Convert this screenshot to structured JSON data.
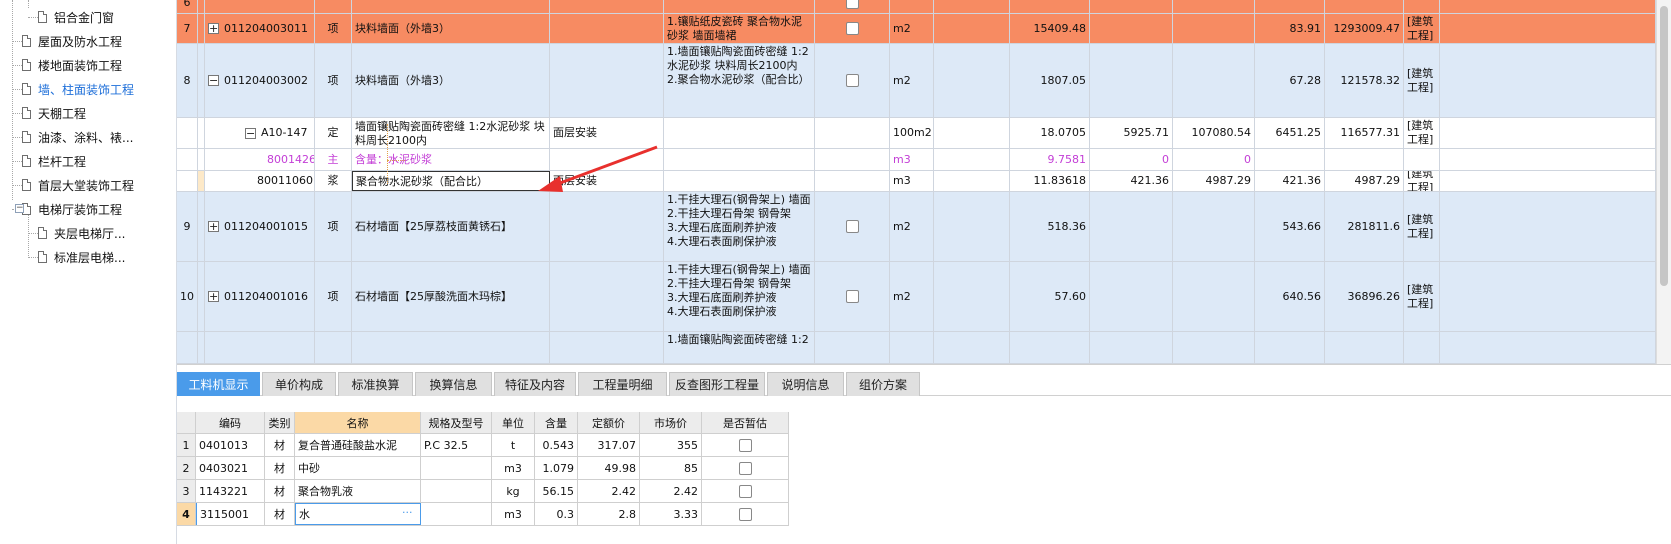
{
  "tree": {
    "items": [
      {
        "label": "铝合金门窗"
      },
      {
        "label": "屋面及防水工程"
      },
      {
        "label": "楼地面装饰工程"
      },
      {
        "label": "墙、柱面装饰工程",
        "selected": true
      },
      {
        "label": "天棚工程"
      },
      {
        "label": "油漆、涂料、裱..."
      },
      {
        "label": "栏杆工程"
      },
      {
        "label": "首层大堂装饰工程"
      },
      {
        "label": "电梯厅装饰工程",
        "expanded": true
      },
      {
        "label": "夹层电梯厅..."
      },
      {
        "label": "标准层电梯..."
      }
    ]
  },
  "grid": {
    "rows": [
      {
        "seq": "6",
        "code": "",
        "type": "",
        "name": "",
        "spec": "",
        "feature": "",
        "unit": "",
        "qty": "",
        "v1": "",
        "v2": "",
        "v3": "",
        "v4": "",
        "prof": "",
        "style": "orange",
        "partial": true
      },
      {
        "seq": "7",
        "code": "011204003011",
        "type": "项",
        "name": "块料墙面（外墙3）",
        "spec": "",
        "feature": "1.镶贴纸皮瓷砖 聚合物水泥砂浆 墙面墙裙",
        "unit": "m2",
        "qty": "15409.48",
        "v1": "",
        "v2": "",
        "v3": "83.91",
        "v4": "1293009.47",
        "prof": "[建筑工程]",
        "style": "orange",
        "expander": "+"
      },
      {
        "seq": "8",
        "code": "011204003002",
        "type": "项",
        "name": "块料墙面（外墙3）",
        "spec": "",
        "feature": "1.墙面镶贴陶瓷面砖密缝 1:2水泥砂浆 块料周长2100内\n2.聚合物水泥砂浆（配合比）",
        "unit": "m2",
        "qty": "1807.05",
        "v1": "",
        "v2": "",
        "v3": "67.28",
        "v4": "121578.32",
        "prof": "[建筑工程]",
        "style": "blue",
        "expander": "−"
      },
      {
        "seq": "",
        "code": "A10-147",
        "type": "定",
        "name": "墙面镶贴陶瓷面砖密缝 1:2水泥砂浆 块料周长2100内",
        "spec": "面层安装",
        "feature": "",
        "unit": "100m2",
        "qty": "18.0705",
        "v1": "5925.71",
        "v2": "107080.54",
        "v3": "6451.25",
        "v4": "116577.31",
        "prof": "[建筑工程]",
        "style": "white",
        "expander": "−"
      },
      {
        "seq": "",
        "code": "8001426",
        "type": "主",
        "name": "含量：水泥砂浆",
        "spec": "",
        "feature": "",
        "unit": "m3",
        "qty": "9.7581",
        "v1": "0",
        "v2": "0",
        "v3": "",
        "v4": "",
        "prof": "",
        "style": "white",
        "purple": true
      },
      {
        "seq": "",
        "code": "80011060l",
        "type": "浆",
        "name": "聚合物水泥砂浆（配合比）",
        "spec": "面层安装",
        "feature": "",
        "unit": "m3",
        "qty": "11.83618",
        "v1": "421.36",
        "v2": "4987.29",
        "v3": "421.36",
        "v4": "4987.29",
        "prof": "[建筑工程]",
        "style": "white"
      },
      {
        "seq": "9",
        "code": "011204001015",
        "type": "项",
        "name": "石材墙面【25厚荔枝面黄锈石】",
        "spec": "",
        "feature": "1.干挂大理石(钢骨架上) 墙面\n2.干挂大理石骨架 钢骨架\n3.大理石底面刷养护液\n4.大理石表面刷保护液",
        "unit": "m2",
        "qty": "518.36",
        "v1": "",
        "v2": "",
        "v3": "543.66",
        "v4": "281811.6",
        "prof": "[建筑工程]",
        "style": "blue",
        "expander": "+"
      },
      {
        "seq": "10",
        "code": "011204001016",
        "type": "项",
        "name": "石材墙面【25厚酸洗面木玛棕】",
        "spec": "",
        "feature": "1.干挂大理石(钢骨架上) 墙面\n2.干挂大理石骨架 钢骨架\n3.大理石底面刷养护液\n4.大理石表面刷保护液",
        "unit": "m2",
        "qty": "57.60",
        "v1": "",
        "v2": "",
        "v3": "640.56",
        "v4": "36896.26",
        "prof": "[建筑工程]",
        "style": "blue",
        "expander": "+"
      },
      {
        "seq": "",
        "code": "",
        "type": "",
        "name": "",
        "spec": "",
        "feature": "1.墙面镶贴陶瓷面砖密缝 1:2",
        "unit": "",
        "qty": "",
        "v1": "",
        "v2": "",
        "v3": "",
        "v4": "",
        "prof": "",
        "style": "blue"
      }
    ]
  },
  "tabs": [
    "工料机显示",
    "单价构成",
    "标准换算",
    "换算信息",
    "特征及内容",
    "工程量明细",
    "反查图形工程量",
    "说明信息",
    "组价方案"
  ],
  "subgrid": {
    "headers": [
      "",
      "编码",
      "类别",
      "名称",
      "规格及型号",
      "单位",
      "含量",
      "定额价",
      "市场价",
      "是否暂估"
    ],
    "rows": [
      {
        "seq": "1",
        "code": "0401013",
        "type": "材",
        "name": "复合普通硅酸盐水泥",
        "spec": "P.C 32.5",
        "unit": "t",
        "qty": "0.543",
        "quota": "317.07",
        "market": "355"
      },
      {
        "seq": "2",
        "code": "0403021",
        "type": "材",
        "name": "中砂",
        "spec": "",
        "unit": "m3",
        "qty": "1.079",
        "quota": "49.98",
        "market": "85"
      },
      {
        "seq": "3",
        "code": "1143221",
        "type": "材",
        "name": "聚合物乳液",
        "spec": "",
        "unit": "kg",
        "qty": "56.15",
        "quota": "2.42",
        "market": "2.42"
      },
      {
        "seq": "4",
        "code": "3115001",
        "type": "材",
        "name": "水",
        "spec": "",
        "unit": "m3",
        "qty": "0.3",
        "quota": "2.8",
        "market": "3.33",
        "editing": true
      }
    ]
  },
  "colors": {
    "orange": "#f78b62",
    "blue": "#dde9f7",
    "accent": "#4a9bea",
    "arrow": "#e8302d",
    "purple": "#c33ed6",
    "selected_tree": "#1e6fd9"
  }
}
